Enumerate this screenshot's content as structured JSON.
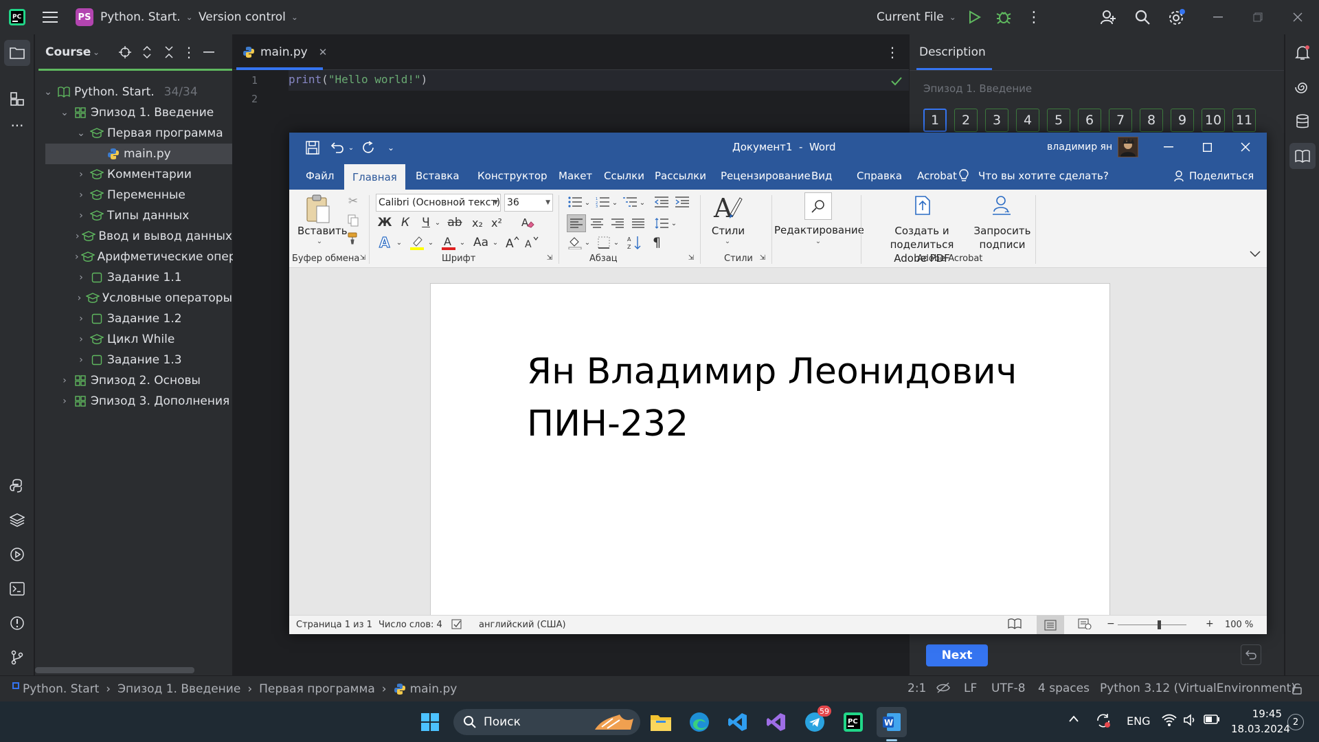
{
  "ide": {
    "project_badge": "PS",
    "project_name": "Python. Start.",
    "version_control": "Version control",
    "run_config": "Current File"
  },
  "course_panel": {
    "title": "Course",
    "tree": [
      {
        "label": "Python. Start.",
        "count": "34/34",
        "level": 0,
        "expanded": true,
        "icon": "book-icon"
      },
      {
        "label": "Эпизод 1. Введение",
        "level": 1,
        "expanded": true,
        "icon": "lesson-grid-icon"
      },
      {
        "label": "Первая программа",
        "level": 2,
        "expanded": true,
        "icon": "task-solved-icon"
      },
      {
        "label": "main.py",
        "level": 3,
        "icon": "python-file-icon",
        "selected": true
      },
      {
        "label": "Комментарии",
        "level": 2,
        "icon": "task-solved-icon"
      },
      {
        "label": "Переменные",
        "level": 2,
        "icon": "task-solved-icon"
      },
      {
        "label": "Типы данных",
        "level": 2,
        "icon": "task-solved-icon"
      },
      {
        "label": "Ввод и вывод данных",
        "level": 2,
        "icon": "task-solved-icon"
      },
      {
        "label": "Арифметические опер",
        "level": 2,
        "icon": "task-solved-icon"
      },
      {
        "label": "Задание 1.1",
        "level": 2,
        "icon": "task-square-icon"
      },
      {
        "label": "Условные операторы",
        "level": 2,
        "icon": "task-solved-icon"
      },
      {
        "label": "Задание 1.2",
        "level": 2,
        "icon": "task-square-icon"
      },
      {
        "label": "Цикл While",
        "level": 2,
        "icon": "task-solved-icon"
      },
      {
        "label": "Задание 1.3",
        "level": 2,
        "icon": "task-square-icon"
      },
      {
        "label": "Эпизод 2. Основы",
        "level": 1,
        "icon": "lesson-grid-icon"
      },
      {
        "label": "Эпизод 3. Дополнения",
        "level": 1,
        "icon": "lesson-grid-icon"
      }
    ]
  },
  "editor": {
    "tab_label": "main.py",
    "lines": [
      "1",
      "2"
    ],
    "code_fn": "print",
    "code_paren_open": "(",
    "code_str": "\"Hello world!\"",
    "code_paren_close": ")"
  },
  "description": {
    "title": "Description",
    "episode": "Эпизод 1. Введение",
    "tasks": [
      "1",
      "2",
      "3",
      "4",
      "5",
      "6",
      "7",
      "8",
      "9",
      "10",
      "11"
    ],
    "next_label": "Next"
  },
  "statusbar": {
    "breadcrumb": [
      "Python. Start",
      "Эпизод 1. Введение",
      "Первая программа",
      "main.py"
    ],
    "position": "2:1",
    "line_sep": "LF",
    "encoding": "UTF-8",
    "indent": "4 spaces",
    "interpreter": "Python 3.12 (VirtualEnvironment)"
  },
  "word": {
    "title": "Документ1  -  Word",
    "user": "владимир ян",
    "tabs": [
      "Файл",
      "Главная",
      "Вставка",
      "Конструктор",
      "Макет",
      "Ссылки",
      "Рассылки",
      "Рецензирование",
      "Вид",
      "Справка",
      "Acrobat"
    ],
    "active_tab": "Главная",
    "tell_me": "Что вы хотите сделать?",
    "share": "Поделиться",
    "paste_label": "Вставить",
    "font_name": "Calibri (Основной текст)",
    "font_size": "36",
    "styles_label": "Стили",
    "editing_label": "Редактирование",
    "create_pdf_line1": "Создать и поделиться",
    "create_pdf_line2": "Adobe PDF",
    "request_sig_line1": "Запросить",
    "request_sig_line2": "подписи",
    "groups": {
      "clipboard": "Буфер обмена",
      "font": "Шрифт",
      "paragraph": "Абзац",
      "styles": "Стили",
      "acrobat": "Adobe Acrobat"
    },
    "font_buttons": {
      "bold": "Ж",
      "italic": "К",
      "underline": "Ч",
      "strike": "ab",
      "sub": "x₂",
      "sup": "x²",
      "case": "Aa"
    },
    "document_lines": [
      "Ян Владимир Леонидович",
      "ПИН-232"
    ],
    "status": {
      "page": "Страница 1 из 1",
      "words": "Число слов: 4",
      "language": "английский (США)",
      "zoom": "100 %"
    }
  },
  "taskbar": {
    "search_placeholder": "Поиск",
    "telegram_badge": "59",
    "lang": "ENG",
    "time": "19:45",
    "date": "18.03.2024",
    "notification_count": "2"
  },
  "colors": {
    "ide_bg": "#1e1f22",
    "panel_bg": "#2b2d30",
    "word_blue": "#2b579a",
    "accent_green": "#5fb85f",
    "next_button": "#3574f0"
  }
}
